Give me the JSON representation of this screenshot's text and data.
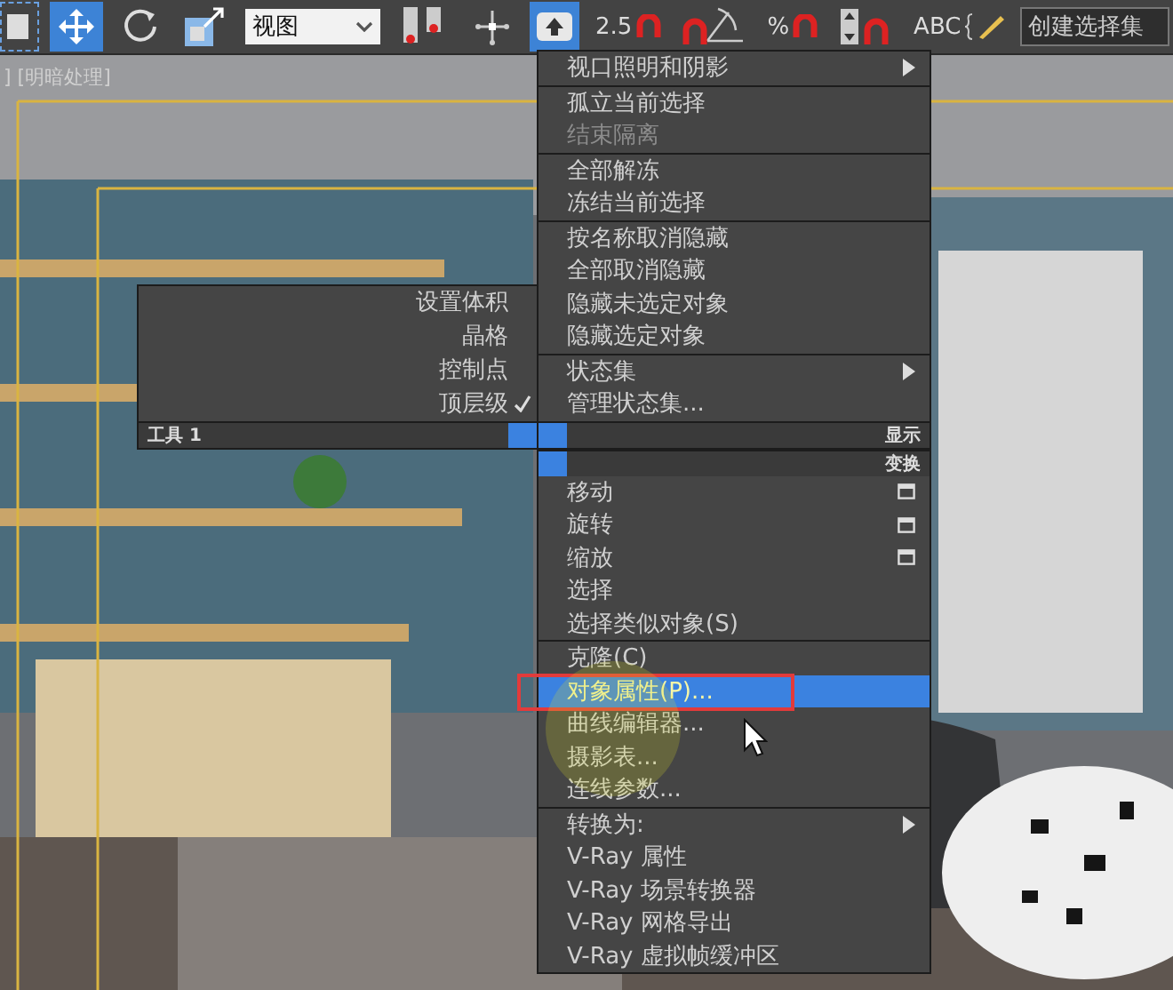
{
  "toolbar": {
    "items": [
      {
        "kind": "region",
        "selected": false
      },
      {
        "kind": "move",
        "selected": true
      },
      {
        "kind": "rotate",
        "selected": false
      },
      {
        "kind": "scale",
        "selected": false
      },
      {
        "kind": "dropdown",
        "value": "视图"
      },
      {
        "kind": "align",
        "selected": false
      },
      {
        "kind": "pivot",
        "selected": false
      },
      {
        "kind": "manipulate",
        "selected": true
      },
      {
        "kind": "snap",
        "label": "2.5",
        "selected": false
      },
      {
        "kind": "angle-snap",
        "selected": false
      },
      {
        "kind": "percent-snap",
        "label": "%",
        "selected": false
      },
      {
        "kind": "spinner-snap",
        "selected": false
      },
      {
        "kind": "named-sets",
        "label": "ABC",
        "selected": false
      },
      {
        "kind": "field",
        "value": "创建选择集"
      }
    ]
  },
  "viewport": {
    "label": "] [明暗处理]",
    "kind": "picture"
  },
  "quad_menu": {
    "tools": {
      "title": "工具 1",
      "items": [
        {
          "label": "设置体积",
          "checked": false,
          "selected": false
        },
        {
          "label": "晶格",
          "checked": false,
          "selected": false
        },
        {
          "label": "控制点",
          "checked": false,
          "selected": false
        },
        {
          "label": "顶层级",
          "checked": true,
          "selected": false
        }
      ]
    },
    "display": {
      "title": "显示",
      "groups": [
        [
          {
            "label": "视口照明和阴影",
            "submenu": true,
            "disabled": false,
            "selected": false
          }
        ],
        [
          {
            "label": "孤立当前选择",
            "submenu": false,
            "disabled": false,
            "selected": false
          },
          {
            "label": "结束隔离",
            "submenu": false,
            "disabled": true,
            "selected": false
          }
        ],
        [
          {
            "label": "全部解冻",
            "submenu": false,
            "disabled": false,
            "selected": false
          },
          {
            "label": "冻结当前选择",
            "submenu": false,
            "disabled": false,
            "selected": false
          }
        ],
        [
          {
            "label": "按名称取消隐藏",
            "submenu": false,
            "disabled": false,
            "selected": false
          },
          {
            "label": "全部取消隐藏",
            "submenu": false,
            "disabled": false,
            "selected": false
          },
          {
            "label": "隐藏未选定对象",
            "submenu": false,
            "disabled": false,
            "selected": false
          },
          {
            "label": "隐藏选定对象",
            "submenu": false,
            "disabled": false,
            "selected": false
          }
        ],
        [
          {
            "label": "状态集",
            "submenu": true,
            "disabled": false,
            "selected": false
          },
          {
            "label": "管理状态集...",
            "submenu": false,
            "disabled": false,
            "selected": false
          }
        ]
      ]
    },
    "transform": {
      "title": "变换",
      "groups": [
        [
          {
            "label": "移动",
            "submenu": false,
            "options_box": true,
            "disabled": false,
            "selected": false,
            "outlined": false
          },
          {
            "label": "旋转",
            "submenu": false,
            "options_box": true,
            "disabled": false,
            "selected": false,
            "outlined": false
          },
          {
            "label": "缩放",
            "submenu": false,
            "options_box": true,
            "disabled": false,
            "selected": false,
            "outlined": false
          },
          {
            "label": "选择",
            "submenu": false,
            "options_box": false,
            "disabled": false,
            "selected": false,
            "outlined": false
          },
          {
            "label": "选择类似对象(S)",
            "submenu": false,
            "options_box": false,
            "disabled": false,
            "selected": false,
            "outlined": false
          }
        ],
        [
          {
            "label": "克隆(C)",
            "submenu": false,
            "options_box": false,
            "disabled": false,
            "selected": false,
            "outlined": false
          },
          {
            "label": "对象属性(P)...",
            "submenu": false,
            "options_box": false,
            "disabled": false,
            "selected": true,
            "outlined": true
          },
          {
            "label": "曲线编辑器...",
            "submenu": false,
            "options_box": false,
            "disabled": false,
            "selected": false,
            "outlined": false
          },
          {
            "label": "摄影表...",
            "submenu": false,
            "options_box": false,
            "disabled": false,
            "selected": false,
            "outlined": false
          },
          {
            "label": "连线参数...",
            "submenu": false,
            "options_box": false,
            "disabled": false,
            "selected": false,
            "outlined": false
          }
        ],
        [
          {
            "label": "转换为:",
            "submenu": true,
            "options_box": false,
            "disabled": false,
            "selected": false,
            "outlined": false
          },
          {
            "label": "V-Ray 属性",
            "submenu": false,
            "options_box": false,
            "disabled": false,
            "selected": false,
            "outlined": false
          },
          {
            "label": "V-Ray 场景转换器",
            "submenu": false,
            "options_box": false,
            "disabled": false,
            "selected": false,
            "outlined": false
          },
          {
            "label": "V-Ray 网格导出",
            "submenu": false,
            "options_box": false,
            "disabled": false,
            "selected": false,
            "outlined": false
          },
          {
            "label": "V-Ray 虚拟帧缓冲区",
            "submenu": false,
            "options_box": false,
            "disabled": false,
            "selected": false,
            "outlined": false
          }
        ]
      ]
    }
  }
}
